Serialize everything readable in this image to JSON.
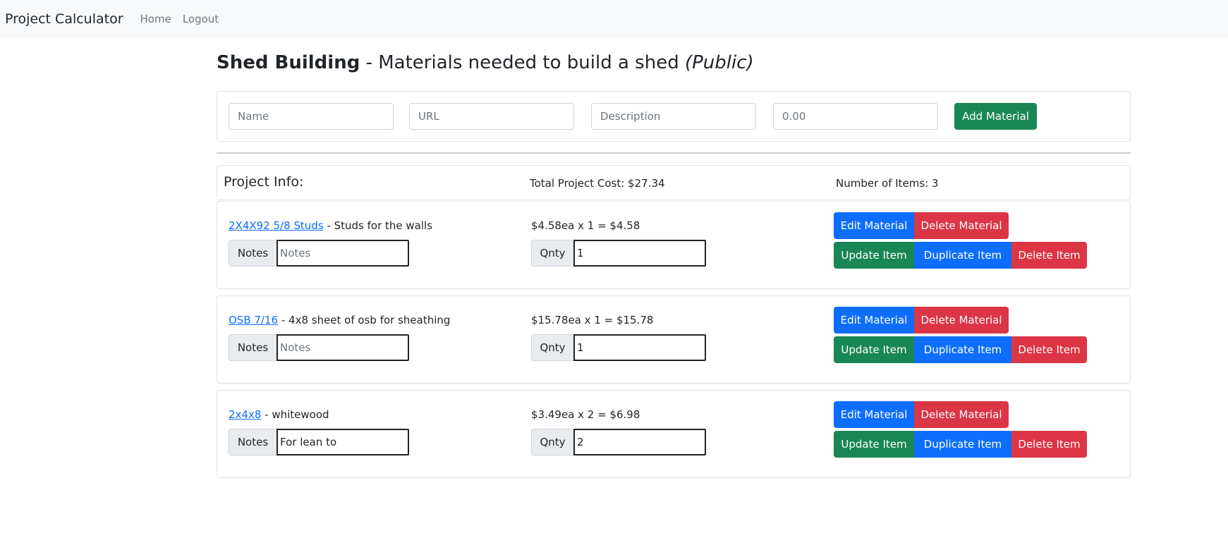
{
  "nav": {
    "brand": "Project Calculator",
    "links": [
      "Home",
      "Logout"
    ]
  },
  "page": {
    "project_name": "Shed Building",
    "separator": " - ",
    "description": "Materials needed to build a shed",
    "visibility": "(Public)"
  },
  "add_form": {
    "name_placeholder": "Name",
    "url_placeholder": "URL",
    "description_placeholder": "Description",
    "price_placeholder": "0.00",
    "add_button": "Add Material"
  },
  "project_info": {
    "title": "Project Info:",
    "total_cost": "Total Project Cost: $27.34",
    "item_count": "Number of Items: 3"
  },
  "labels": {
    "notes": "Notes",
    "notes_placeholder": "Notes",
    "qty": "Qnty",
    "edit_material": "Edit Material",
    "delete_material": "Delete Material",
    "update_item": "Update Item",
    "duplicate_item": "Duplicate Item",
    "delete_item": "Delete Item"
  },
  "items": [
    {
      "name": "2X4X92 5/8 Studs",
      "description": " - Studs for the walls",
      "price_line": "$4.58ea x 1 = $4.58",
      "notes": "",
      "qty": "1"
    },
    {
      "name": "OSB 7/16",
      "description": " - 4x8 sheet of osb for sheathing",
      "price_line": "$15.78ea x 1 = $15.78",
      "notes": "",
      "qty": "1"
    },
    {
      "name": "2x4x8",
      "description": " - whitewood",
      "price_line": "$3.49ea x 2 = $6.98",
      "notes": "For lean to",
      "qty": "2"
    }
  ],
  "colors": {
    "primary": "#0d6efd",
    "success": "#198754",
    "danger": "#dc3545",
    "navbar_bg": "#f8f9fa"
  }
}
